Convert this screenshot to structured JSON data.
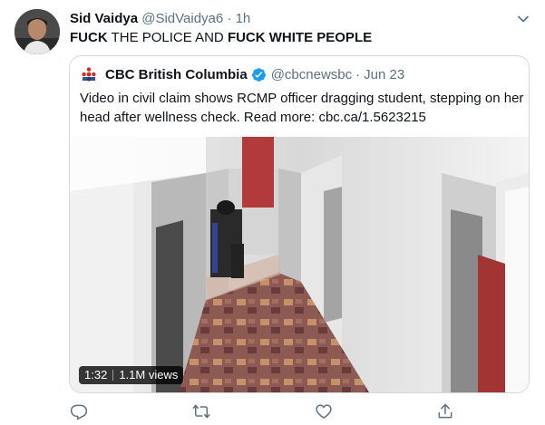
{
  "tweet": {
    "display_name": "Sid Vaidya",
    "handle": "@SidVaidya6",
    "dot": "·",
    "time": "1h",
    "text_part1": "FUCK",
    "text_part2": " THE POLICE AND ",
    "text_part3": "FUCK WHITE PEOPLE"
  },
  "quote": {
    "name": "CBC British Columbia",
    "handle": "@cbcnewsbc",
    "dot": "·",
    "date": "Jun 23",
    "text": "Video in civil claim shows RCMP officer dragging student, stepping on her head after wellness check. Read more: cbc.ca/1.5623215"
  },
  "video": {
    "duration": "1:32",
    "views": "1.1M views"
  },
  "icons": {
    "avatar": "avatar-photo",
    "caret": "chevron-down-icon",
    "verified": "verified-badge-icon",
    "logo": "cbc-logo-icon",
    "reply": "reply-icon",
    "retweet": "retweet-icon",
    "like": "heart-icon",
    "share": "share-icon"
  },
  "colors": {
    "text": "#0f1419",
    "secondary": "#5b7083",
    "border": "#cfd9de",
    "verified": "#1d9bf0",
    "cbc_red": "#d42b1e"
  }
}
